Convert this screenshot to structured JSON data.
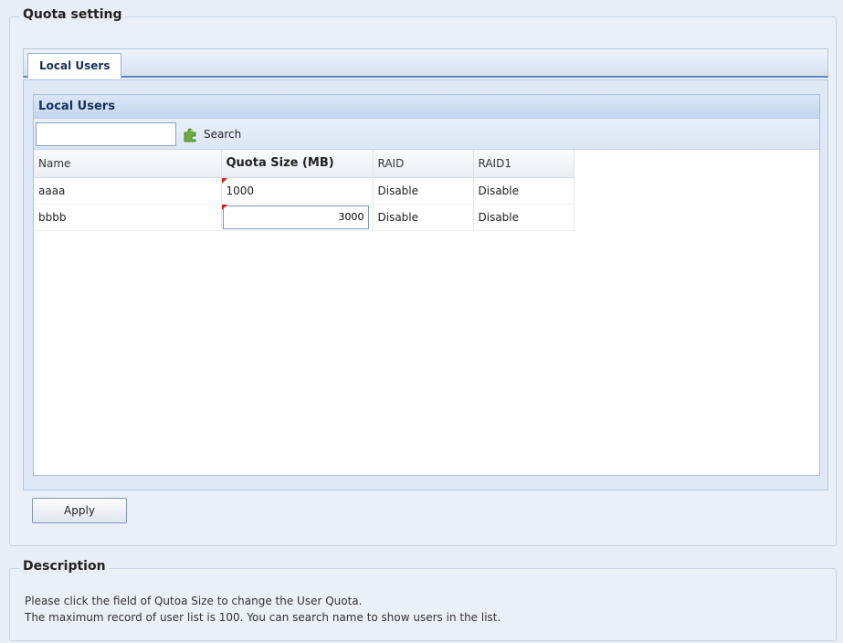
{
  "quota_section": {
    "title": "Quota setting"
  },
  "tabs": [
    {
      "label": "Local Users"
    }
  ],
  "panel": {
    "title": "Local Users"
  },
  "search": {
    "placeholder": "",
    "value": "",
    "button_label": "Search"
  },
  "table": {
    "columns": [
      "Name",
      "Quota Size (MB)",
      "RAID",
      "RAID1"
    ],
    "rows": [
      {
        "name": "aaaa",
        "quota": "1000",
        "raid": "Disable",
        "raid1": "Disable",
        "quota_modified": true
      },
      {
        "name": "bbbb",
        "quota": "3000",
        "raid": "Disable",
        "raid1": "Disable",
        "quota_editing": true
      }
    ]
  },
  "actions": {
    "apply_label": "Apply"
  },
  "description": {
    "title": "Description",
    "lines": [
      "Please click the field of Qutoa Size to change the User Quota.",
      "The maximum record of user list is 100. You can search name to show users in the list."
    ]
  },
  "colors": {
    "background": "#e8eef7",
    "panel_header": "#c4d6ee",
    "dirty_marker": "#d02020"
  },
  "icons": {
    "search": "search-puzzle-icon"
  }
}
